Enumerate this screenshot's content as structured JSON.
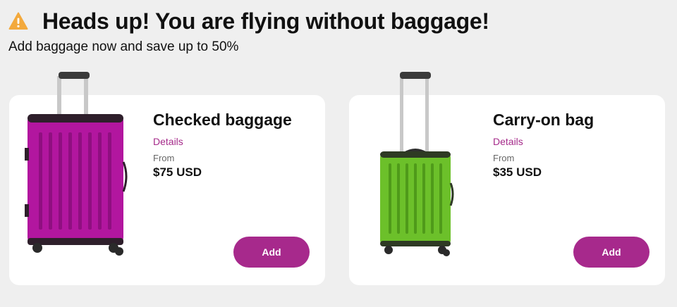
{
  "header": {
    "title": "Heads up! You are flying without baggage!",
    "subtitle": "Add baggage now and save up to 50%",
    "icon": "warning-icon"
  },
  "cards": [
    {
      "title": "Checked baggage",
      "details_label": "Details",
      "from_label": "From",
      "price": "$75 USD",
      "add_label": "Add",
      "bag_color": "#b2169f"
    },
    {
      "title": "Carry-on bag",
      "details_label": "Details",
      "from_label": "From",
      "price": "$35 USD",
      "add_label": "Add",
      "bag_color": "#6cc02a"
    }
  ],
  "colors": {
    "accent": "#a7298c",
    "warning": "#f3a93c",
    "background": "#efefef"
  }
}
